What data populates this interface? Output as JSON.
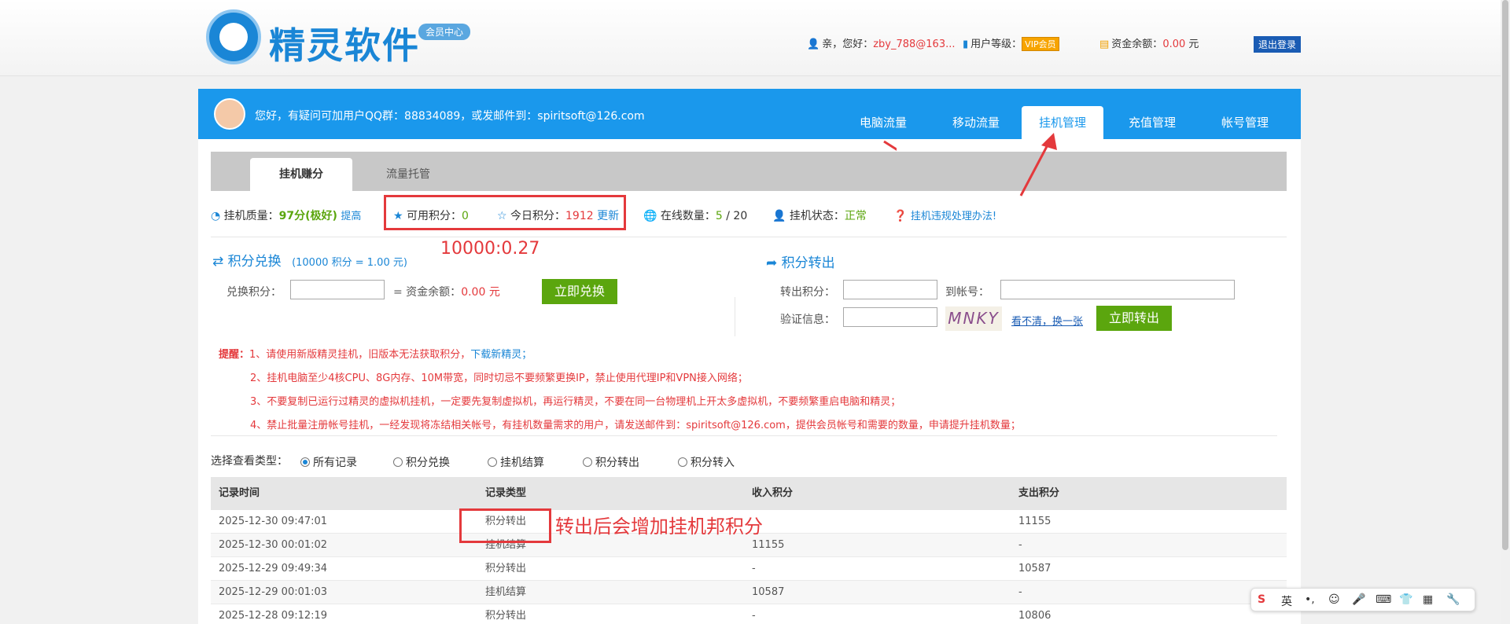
{
  "header": {
    "brand": "精灵软件",
    "badge": "会员中心",
    "greeting_prefix": "亲，您好：",
    "username": "zby_788@163...",
    "level_label": "用户等级：",
    "level_value": "VIP会员",
    "balance_label": "资金余额：",
    "balance_value": "0.00",
    "balance_unit": "元",
    "logout": "退出登录"
  },
  "bluebar": {
    "notice": "您好，有疑问可加用户QQ群：88834089，或发邮件到：spiritsoft@126.com",
    "tabs": [
      "电脑流量",
      "移动流量",
      "挂机管理",
      "充值管理",
      "帐号管理"
    ],
    "active_tab": "挂机管理"
  },
  "subtabs": [
    "挂机赚分",
    "流量托管"
  ],
  "stats": {
    "quality_label": "挂机质量：",
    "quality_value": "97分(极好)",
    "quality_link": "提高",
    "available_label": "可用积分：",
    "available_value": "0",
    "today_label": "今日积分：",
    "today_value": "1912",
    "refresh": "更新",
    "online_label": "在线数量：",
    "online_value": "5",
    "online_total": "/ 20",
    "status_label": "挂机状态：",
    "status_value": "正常",
    "violation_link": "挂机违规处理办法!"
  },
  "annotations": {
    "ratio": "10000:0.27",
    "transfer_note": "转出后会增加挂机邦积分"
  },
  "exchange": {
    "title": "积分兑换",
    "rate": "(10000 积分 = 1.00 元)",
    "label": "兑换积分：",
    "eq": "= 资金余额：",
    "result": "0.00",
    "unit": "元",
    "button": "立即兑换"
  },
  "transfer": {
    "title": "积分转出",
    "points_label": "转出积分：",
    "account_label": "到帐号：",
    "verify_label": "验证信息：",
    "captcha": "MNKY",
    "refresh_captcha": "看不清，换一张",
    "button": "立即转出"
  },
  "reminders": {
    "prefix": "提醒：",
    "line1": "1、请使用新版精灵挂机，旧版本无法获取积分，",
    "line1_link": "下载新精灵；",
    "line2": "2、挂机电脑至少4核CPU、8G内存、10M带宽，同时切忌不要频繁更换IP，禁止使用代理IP和VPN接入网络；",
    "line3": "3、不要复制已运行过精灵的虚拟机挂机，一定要先复制虚拟机，再运行精灵，不要在同一台物理机上开太多虚拟机，不要频繁重启电脑和精灵；",
    "line4": "4、禁止批量注册帐号挂机，一经发现将冻结相关帐号，有挂机数量需求的用户，请发送邮件到：spiritsoft@126.com，提供会员帐号和需要的数量，申请提升挂机数量；"
  },
  "filter": {
    "label": "选择查看类型：",
    "options": [
      "所有记录",
      "积分兑换",
      "挂机结算",
      "积分转出",
      "积分转入"
    ],
    "selected": "所有记录"
  },
  "table": {
    "headers": [
      "记录时间",
      "记录类型",
      "收入积分",
      "支出积分"
    ],
    "rows": [
      [
        "2025-12-30 09:47:01",
        "积分转出",
        "",
        "11155"
      ],
      [
        "2025-12-30 00:01:02",
        "挂机结算",
        "11155",
        "-"
      ],
      [
        "2025-12-29 09:49:34",
        "积分转出",
        "-",
        "10587"
      ],
      [
        "2025-12-29 00:01:03",
        "挂机结算",
        "10587",
        "-"
      ],
      [
        "2025-12-28 09:12:19",
        "积分转出",
        "-",
        "10806"
      ]
    ]
  },
  "ime": [
    "英",
    "•,",
    "☺",
    "🎤",
    "⌨",
    "👕",
    "▦",
    "🔧"
  ],
  "colors": {
    "primary": "#1a98ec",
    "accent_green": "#5ba60e",
    "warning_red": "#e4393c"
  }
}
